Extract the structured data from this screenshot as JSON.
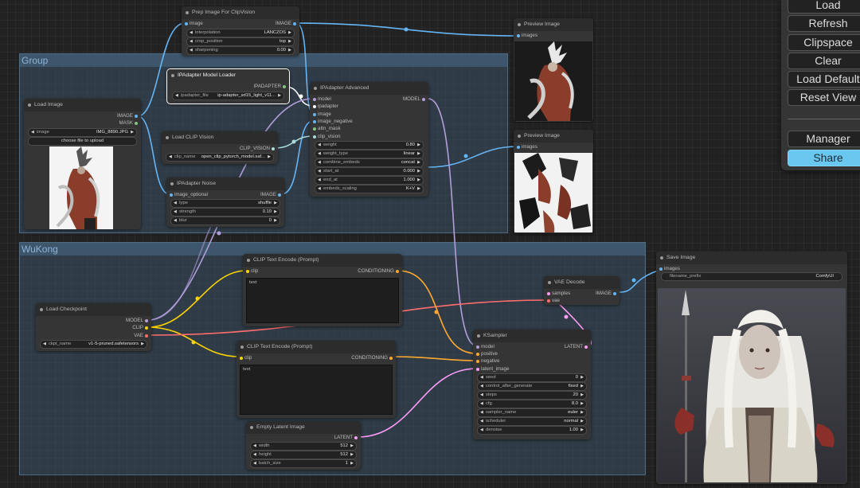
{
  "groups": {
    "group": "Group",
    "wukong": "WuKong"
  },
  "colors": {
    "image": "#64b5f6",
    "mask": "#81c784",
    "model": "#b39ddb",
    "clip": "#ffd500",
    "vae": "#ff6e6e",
    "conditioning": "#ffa931",
    "latent": "#ff9cf9",
    "ipadapter": "#ffffff",
    "clip_vision": "#a8dadc",
    "accent": "#6ac8f0"
  },
  "nodes": {
    "prep": {
      "title": "Prep Image For ClipVision",
      "in_image": "image",
      "out_image": "IMAGE",
      "widgets": [
        {
          "label": "interpolation",
          "value": "LANCZOS"
        },
        {
          "label": "crop_position",
          "value": "top"
        },
        {
          "label": "sharpening",
          "value": "0.00"
        }
      ]
    },
    "preview1": {
      "title": "Preview Image",
      "in_images": "images"
    },
    "preview2": {
      "title": "Preview Image",
      "in_images": "images"
    },
    "loader": {
      "title": "IPAdapter Model Loader",
      "out": "IPADAPTER",
      "widget_label": "ipadapter_file",
      "widget_value": "ip-adapter_sd15_light_v11..."
    },
    "advanced": {
      "title": "IPAdapter Advanced",
      "out": "MODEL",
      "inputs": [
        "model",
        "ipadapter",
        "image",
        "image_negative",
        "attn_mask",
        "clip_vision"
      ],
      "widgets": [
        {
          "label": "weight",
          "value": "0.80"
        },
        {
          "label": "weight_type",
          "value": "linear"
        },
        {
          "label": "combine_embeds",
          "value": "concat"
        },
        {
          "label": "start_at",
          "value": "0.000"
        },
        {
          "label": "end_at",
          "value": "1.000"
        },
        {
          "label": "embeds_scaling",
          "value": "K+V"
        }
      ]
    },
    "loadimage": {
      "title": "Load Image",
      "out_image": "IMAGE",
      "out_mask": "MASK",
      "widget_label": "image",
      "widget_value": "IMG_8890.JPG",
      "upload": "choose file to upload"
    },
    "clipvision": {
      "title": "Load CLIP Vision",
      "out": "CLIP_VISION",
      "widget_label": "clip_name",
      "widget_value": "open_clip_pytorch_model.saf..."
    },
    "noise": {
      "title": "IPAdapter Noise",
      "in": "image_optional",
      "out": "IMAGE",
      "widgets": [
        {
          "label": "type",
          "value": "shuffle"
        },
        {
          "label": "strength",
          "value": "0.10"
        },
        {
          "label": "blur",
          "value": "0"
        }
      ]
    },
    "clipenc1": {
      "title": "CLIP Text Encode (Prompt)",
      "in": "clip",
      "out": "CONDITIONING",
      "text": "text"
    },
    "clipenc2": {
      "title": "CLIP Text Encode (Prompt)",
      "in": "clip",
      "out": "CONDITIONING",
      "text": "text"
    },
    "checkpoint": {
      "title": "Load Checkpoint",
      "outs": [
        "MODEL",
        "CLIP",
        "VAE"
      ],
      "widget_label": "ckpt_name",
      "widget_value": "v1-5-pruned.safetensors"
    },
    "vaedecode": {
      "title": "VAE Decode",
      "inputs": [
        "samples",
        "vae"
      ],
      "out": "IMAGE"
    },
    "ksampler": {
      "title": "KSampler",
      "inputs": [
        "model",
        "positive",
        "negative",
        "latent_image"
      ],
      "out": "LATENT",
      "widgets": [
        {
          "label": "seed",
          "value": "0"
        },
        {
          "label": "control_after_generate",
          "value": "fixed"
        },
        {
          "label": "steps",
          "value": "20"
        },
        {
          "label": "cfg",
          "value": "8.0"
        },
        {
          "label": "sampler_name",
          "value": "euler"
        },
        {
          "label": "scheduler",
          "value": "normal"
        },
        {
          "label": "denoise",
          "value": "1.00"
        }
      ]
    },
    "emptylatent": {
      "title": "Empty Latent Image",
      "out": "LATENT",
      "widgets": [
        {
          "label": "width",
          "value": "512"
        },
        {
          "label": "height",
          "value": "512"
        },
        {
          "label": "batch_size",
          "value": "1"
        }
      ]
    },
    "saveimage": {
      "title": "Save Image",
      "in": "images",
      "widget_label": "filename_prefix",
      "widget_value": "ComfyUI"
    }
  },
  "menu": {
    "load": "Load",
    "refresh": "Refresh",
    "clipspace": "Clipspace",
    "clear": "Clear",
    "load_default": "Load Default",
    "reset_view": "Reset View",
    "manager": "Manager",
    "share": "Share"
  }
}
